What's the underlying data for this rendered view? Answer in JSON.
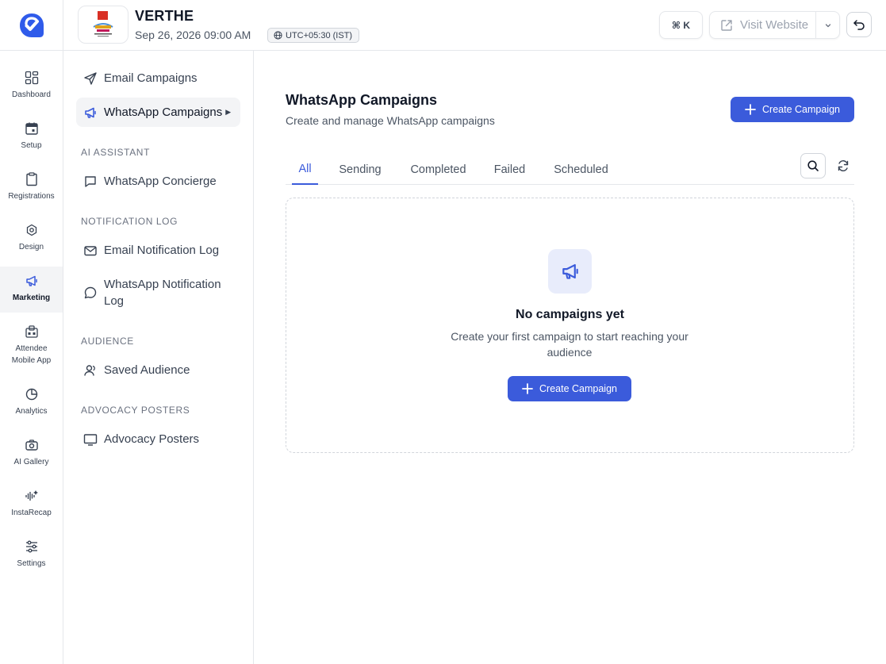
{
  "header": {
    "event_name": "VERTHE",
    "event_date": "Sep 26, 2026 09:00 AM",
    "timezone": "UTC+05:30 (IST)",
    "shortcut_label": "⌘ K",
    "visit_website_label": "Visit Website"
  },
  "rail": {
    "items": [
      {
        "label": "Dashboard",
        "icon": "dashboard-icon"
      },
      {
        "label": "Setup",
        "icon": "calendar-icon"
      },
      {
        "label": "Registrations",
        "icon": "clipboard-icon"
      },
      {
        "label": "Design",
        "icon": "design-icon"
      },
      {
        "label": "Marketing",
        "icon": "megaphone-icon",
        "active": true
      },
      {
        "label_line1": "Attendee",
        "label_line2": "Mobile App",
        "icon": "mobile-app-icon"
      },
      {
        "label": "Analytics",
        "icon": "pie-chart-icon"
      },
      {
        "label": "AI Gallery",
        "icon": "camera-icon"
      },
      {
        "label": "InstaRecap",
        "icon": "audio-wave-icon"
      },
      {
        "label": "Settings",
        "icon": "sliders-icon"
      }
    ]
  },
  "subnav": {
    "email_campaigns": "Email Campaigns",
    "whatsapp_campaigns": "WhatsApp Campaigns",
    "ai_assistant_heading": "AI ASSISTANT",
    "whatsapp_concierge": "WhatsApp Concierge",
    "notification_log_heading": "NOTIFICATION LOG",
    "email_notification_log": "Email Notification Log",
    "whatsapp_notification_log_line1": "WhatsApp Notification",
    "whatsapp_notification_log_line2": "Log",
    "audience_heading": "AUDIENCE",
    "saved_audience": "Saved Audience",
    "advocacy_heading": "ADVOCACY POSTERS",
    "advocacy_posters": "Advocacy Posters"
  },
  "main": {
    "title": "WhatsApp Campaigns",
    "subtitle": "Create and manage WhatsApp campaigns",
    "create_label": "Create Campaign",
    "tabs": [
      {
        "label": "All",
        "active": true
      },
      {
        "label": "Sending"
      },
      {
        "label": "Completed"
      },
      {
        "label": "Failed"
      },
      {
        "label": "Scheduled"
      }
    ],
    "empty_title": "No campaigns yet",
    "empty_text": "Create your first campaign to start reaching your audience",
    "empty_create_label": "Create Campaign"
  },
  "colors": {
    "accent": "#3b5bdb",
    "accent_soft": "#e8ecfb",
    "border": "#e5e7eb",
    "logo_blue": "#2f5bea"
  }
}
